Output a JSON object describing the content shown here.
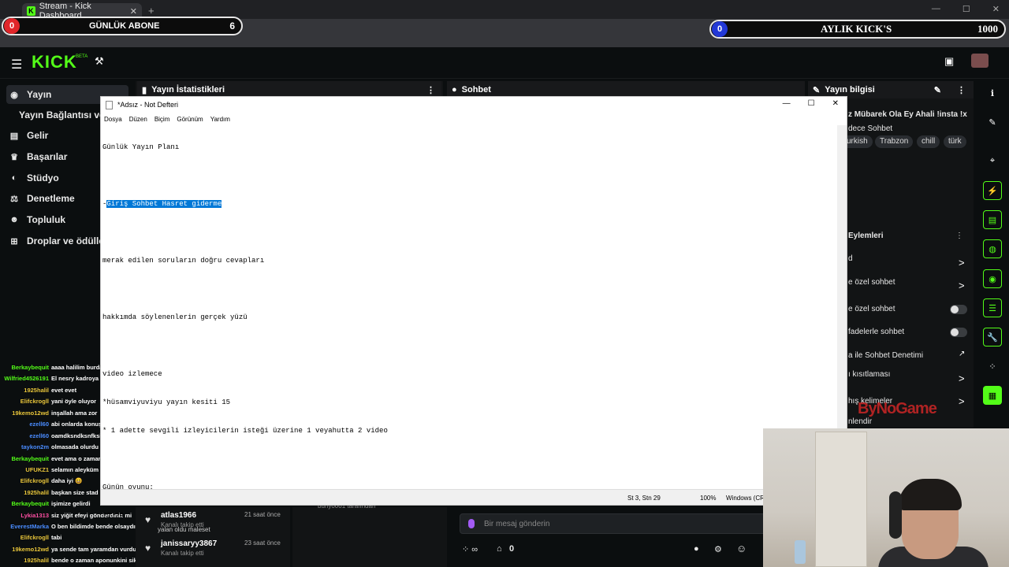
{
  "browser": {
    "tab_title": "Stream - Kick Dashboard",
    "tab_close": "✕",
    "new_tab": "+",
    "url": "dashboard.kick.com/stream",
    "win_ctrls": [
      "—",
      "☐",
      "✕"
    ]
  },
  "overlays": {
    "daily": {
      "left_value": "0",
      "label": "GÜNLÜK ABONE",
      "count": "6",
      "dot_color": "#e0262a"
    },
    "monthly": {
      "left_value": "0",
      "label": "AYLIK KICK'S",
      "count": "1000",
      "dot_color": "#2238d6"
    }
  },
  "header": {
    "logo": "KICK",
    "beta": "BETA"
  },
  "sidebar": {
    "items": [
      {
        "label": "Yayın",
        "icon": "broadcast-icon"
      },
      {
        "label": "Yayın Bağlantısı ve A",
        "icon": ""
      },
      {
        "label": "Gelir",
        "icon": "revenue-icon"
      },
      {
        "label": "Başarılar",
        "icon": "trophy-icon"
      },
      {
        "label": "Stüdyo",
        "icon": "studio-icon"
      },
      {
        "label": "Denetleme",
        "icon": "moderation-icon"
      },
      {
        "label": "Topluluk",
        "icon": "community-icon"
      },
      {
        "label": "Droplar ve ödüller",
        "icon": "drops-icon"
      }
    ]
  },
  "panels": {
    "stats": "Yayın İstatistikleri",
    "chat": "Sohbet",
    "info": "Yayın bilgisi"
  },
  "info": {
    "title_partial": "z Mübarek Ola Ey Ahali !insta !x",
    "category": "dece Sohbet",
    "tags": [
      "urkish",
      "Trabzon",
      "chill",
      "türk"
    ],
    "actions_title": "Eylemleri",
    "actions": [
      "d",
      "e özel sohbet",
      "e özel sohbet",
      "fadelerle sohbet",
      "a ile Sohbet Denetimi",
      "ı kısıtlaması",
      "hış kelimeler",
      "nlendir"
    ]
  },
  "notepad": {
    "title": "*Adsız - Not Defteri",
    "menu": [
      "Dosya",
      "Düzen",
      "Biçim",
      "Görünüm",
      "Yardım"
    ],
    "lines": [
      "Günlük Yayın Planı",
      "",
      "-",
      "",
      "merak edilen soruların doğru cevapları",
      "",
      "hakkımda söylenenlerin gerçek yüzü",
      "",
      "video izlemece",
      "*hüsamviyuviyu yayın kesiti 15",
      "* 1 adette sevgili izleyicilerin isteği üzerine 1 veyahutta 2 video",
      "",
      "Günün oyunu:",
      "?????"
    ],
    "selected": "Giriş Sohbet Hasret giderme",
    "status": {
      "pos": "St 3, Stn 29",
      "zoom": "100%",
      "encoding": "Windows (CR"
    }
  },
  "chat_overlay": [
    {
      "user": "Berkaybequit",
      "color": "#53fc18",
      "msg": "aaaa halilim burdayım"
    },
    {
      "user": "Wilfried4526191",
      "color": "#53fc18",
      "msg": "El nesry kadroya"
    },
    {
      "user": "1925halil",
      "color": "#e8c53a",
      "msg": "evet evet"
    },
    {
      "user": "Elifckrogll",
      "color": "#e8c53a",
      "msg": "yani öyle oluyor"
    },
    {
      "user": "19kemo12wd",
      "color": "#e8c53a",
      "msg": "inşallah ama zor"
    },
    {
      "user": "ezell60",
      "color": "#4a8cff",
      "msg": "abi onlarda konuşu"
    },
    {
      "user": "ezell60",
      "color": "#4a8cff",
      "msg": "oamdksndksnfksi"
    },
    {
      "user": "taykon2m",
      "color": "#4a8cff",
      "msg": "olmasada olurdu"
    },
    {
      "user": "Berkaybequit",
      "color": "#53fc18",
      "msg": "evet ama o zaman"
    },
    {
      "user": "UFUKZ1",
      "color": "#e8c53a",
      "msg": "selamın aleyküm"
    },
    {
      "user": "Elifckrogll",
      "color": "#e8c53a",
      "msg": "daha iyi 😆"
    },
    {
      "user": "1925halil",
      "color": "#e8c53a",
      "msg": "başkan size stad"
    },
    {
      "user": "Berkaybequit",
      "color": "#53fc18",
      "msg": "işimize gelirdi"
    },
    {
      "user": "Lykia1313",
      "color": "#ff4fa3",
      "msg": "siz yiğit efeyi gönderdiniz mi"
    },
    {
      "user": "EverestMarka",
      "color": "#4a8cff",
      "msg": "O ben bildimde bende olsaydım bütün elleri atılan"
    },
    {
      "user": "Elifckrogll",
      "color": "#e8c53a",
      "msg": "tabi"
    },
    {
      "user": "19kemo12wd",
      "color": "#e8c53a",
      "msg": "ya sende tam yaramdan vurdun ya"
    },
    {
      "user": "1925halil",
      "color": "#e8c53a",
      "msg": "bende o zaman aponunkini sikim"
    }
  ],
  "followers": [
    {
      "name": "atlas1966",
      "sub": "Kanalı takip etti",
      "time": "21 saat önce"
    },
    {
      "name": "janissaryy3867",
      "sub": "Kanalı takip etti",
      "time": "23 saat önce"
    }
  ],
  "bottom": {
    "partial": "buny0001 tarafından",
    "faint1": "yalan oldu maleset",
    "message_placeholder": "Bir mesaj gönderin",
    "viewer_count": "0"
  },
  "watermark": "ByNoGame"
}
